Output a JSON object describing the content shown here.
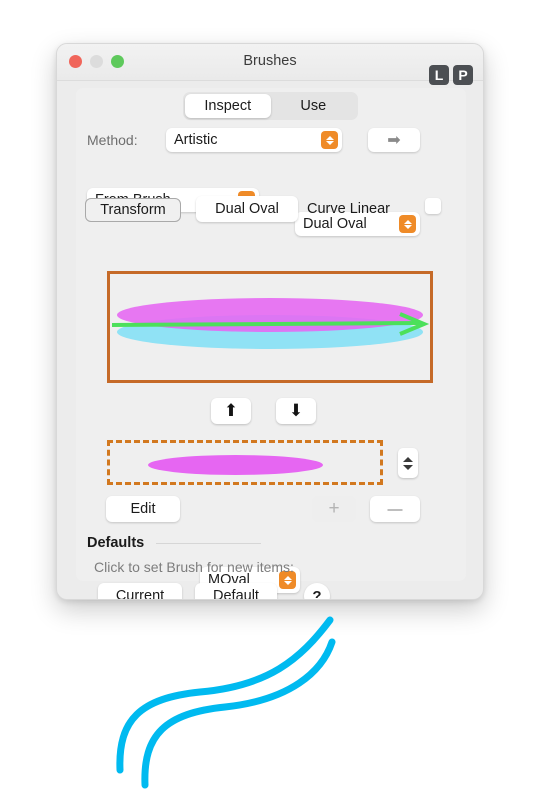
{
  "window": {
    "title": "Brushes",
    "traffic_lights": [
      "close-button",
      "minimize-button",
      "zoom-button"
    ],
    "badges": [
      {
        "name": "layers-badge",
        "label": "L"
      },
      {
        "name": "properties-badge",
        "label": "P"
      }
    ]
  },
  "tabs": [
    {
      "label": "Inspect",
      "active": true
    },
    {
      "label": "Use",
      "active": false
    }
  ],
  "method_row": {
    "label": "Method:",
    "value": "Artistic",
    "apply_arrow": "➡"
  },
  "source_row": {
    "source_value": "From Brush",
    "shape_value": "Dual Oval"
  },
  "transform_row": {
    "transform_label": "Transform",
    "shape_label": "Dual Oval",
    "curve_linear_label": "Curve Linear",
    "curve_linear_checked": false
  },
  "preview": {
    "border_color": "#c56a28",
    "background": "#efefef",
    "shapes": [
      {
        "name": "magenta-oval",
        "color": "#e666f2"
      },
      {
        "name": "cyan-oval",
        "color": "#90e2f5"
      },
      {
        "name": "direction-arrow",
        "color": "#4ce05a"
      }
    ]
  },
  "order_buttons": {
    "move_up": "⬆",
    "move_down": "⬇"
  },
  "selection": {
    "border_color": "#d2781f",
    "oval_color": "#e666f2",
    "stepper": "value-stepper"
  },
  "edit_row": {
    "edit_label": "Edit",
    "shape_value": "MOval",
    "add_label": "+",
    "add_enabled": false,
    "remove_label": "—",
    "remove_enabled": true
  },
  "defaults": {
    "title": "Defaults",
    "hint": "Click to set Brush for new items:",
    "current_label": "Current",
    "default_label": "Default",
    "help_label": "?"
  },
  "decoration": {
    "swoosh_color": "#00baf0"
  }
}
